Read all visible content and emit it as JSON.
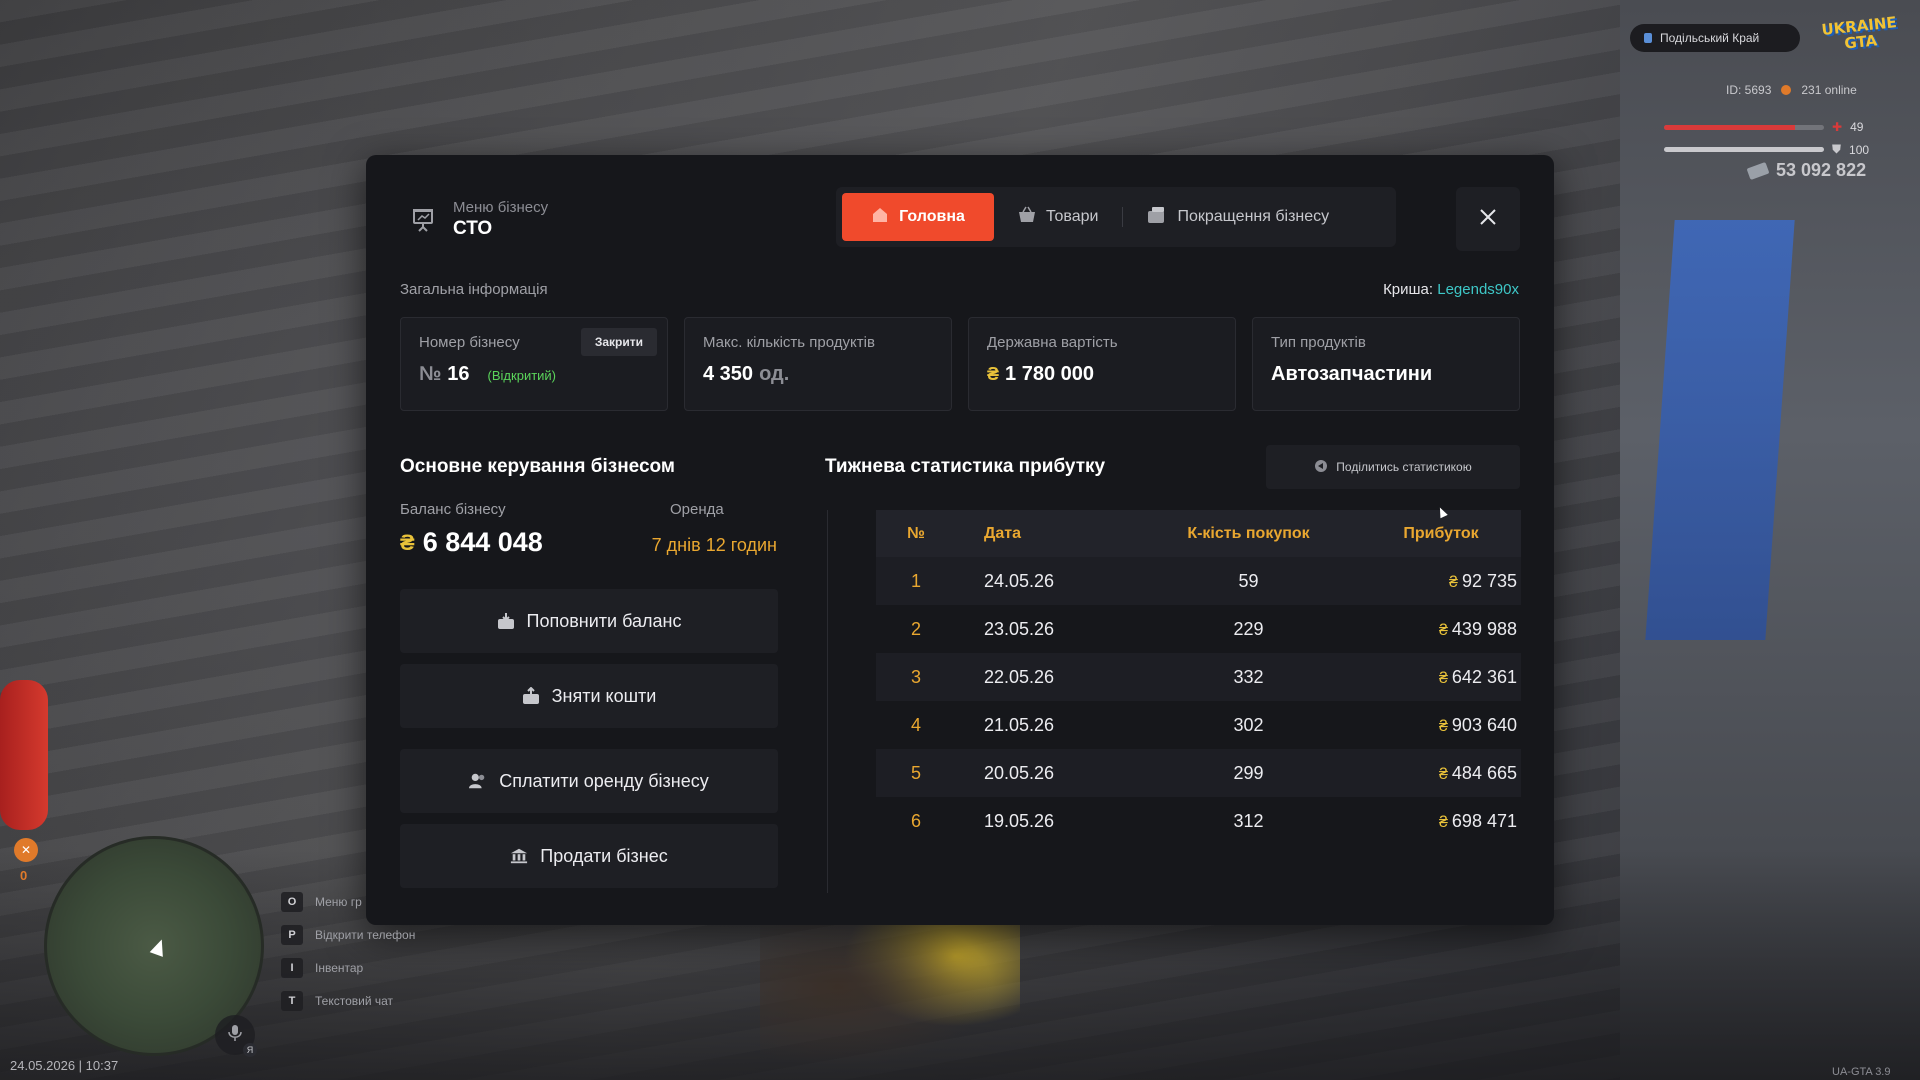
{
  "hud": {
    "server_name": "Подільський Край",
    "logo_line1": "UKRAINE",
    "logo_line2": "GTA",
    "id_label": "ID: 5693",
    "online_label": "231 online",
    "health_value": "49",
    "health_fraction": 0.82,
    "armor_value": "100",
    "armor_fraction": 1.0,
    "cash": "53 092 822",
    "datetime": "24.05.2026 | 10:37",
    "version": "UA-GTA 3.9",
    "extinguisher_count": "0",
    "key_hints": [
      {
        "key": "O",
        "label": "Меню гр"
      },
      {
        "key": "P",
        "label": "Відкрити телефон"
      },
      {
        "key": "I",
        "label": "Інвентар"
      },
      {
        "key": "T",
        "label": "Текстовий чат"
      }
    ],
    "mic_badge": "Я"
  },
  "modal": {
    "menu_subtitle": "Меню бізнесу",
    "menu_title": "СТО",
    "tabs": [
      {
        "label": "Головна",
        "active": true,
        "icon": "home-icon"
      },
      {
        "label": "Товари",
        "active": false,
        "icon": "basket-icon"
      },
      {
        "label": "Покращення бізнесу",
        "active": false,
        "icon": "upgrade-icon"
      }
    ],
    "general_info_label": "Загальна інформація",
    "roof_label": "Криша:",
    "roof_value": "Legends90x",
    "cards": {
      "number": {
        "label": "Номер бізнесу",
        "prefix": "№",
        "value": "16",
        "status": "(Відкритий)",
        "close_button": "Закрити"
      },
      "max_products": {
        "label": "Макс. кількість продуктів",
        "value": "4 350",
        "unit": "од."
      },
      "state_value": {
        "label": "Державна вартість",
        "currency": "₴",
        "value": "1 780 000"
      },
      "product_type": {
        "label": "Тип продуктів",
        "value": "Автозапчастини"
      }
    },
    "management": {
      "title": "Основне керування бізнесом",
      "balance_label": "Баланс бізнесу",
      "balance_currency": "₴",
      "balance_value": "6 844 048",
      "rent_label": "Оренда",
      "rent_value": "7 днів 12 годин",
      "buttons": [
        {
          "label": "Поповнити баланс",
          "icon": "deposit-icon"
        },
        {
          "label": "Зняти кошти",
          "icon": "withdraw-icon"
        },
        {
          "label": "Сплатити оренду бізнесу",
          "icon": "users-icon"
        },
        {
          "label": "Продати бізнес",
          "icon": "bank-icon"
        }
      ]
    },
    "stats": {
      "title": "Тижнева статистика прибутку",
      "share_label": "Поділитись статистикою",
      "headers": [
        "№",
        "Дата",
        "К-кість покупок",
        "Прибуток"
      ],
      "currency": "₴",
      "rows": [
        {
          "n": "1",
          "date": "24.05.26",
          "count": "59",
          "profit": "92 735"
        },
        {
          "n": "2",
          "date": "23.05.26",
          "count": "229",
          "profit": "439 988"
        },
        {
          "n": "3",
          "date": "22.05.26",
          "count": "332",
          "profit": "642 361"
        },
        {
          "n": "4",
          "date": "21.05.26",
          "count": "302",
          "profit": "903 640"
        },
        {
          "n": "5",
          "date": "20.05.26",
          "count": "299",
          "profit": "484 665"
        },
        {
          "n": "6",
          "date": "19.05.26",
          "count": "312",
          "profit": "698 471"
        }
      ]
    }
  },
  "colors": {
    "accent": "#f04a2c",
    "gold": "#e9a730",
    "currency": "#e9c23a",
    "roof": "#3ec7c7",
    "open_status": "#5ad45a",
    "health": "#d93a3a",
    "armor": "#c9c9cd"
  }
}
